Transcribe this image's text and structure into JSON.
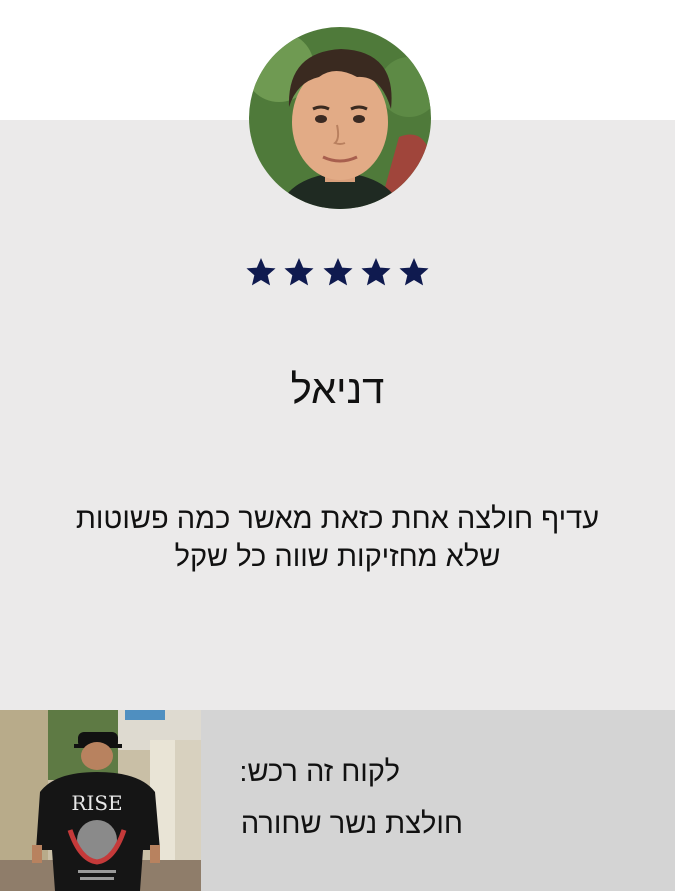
{
  "review": {
    "avatar_icon": "person-avatar-photo",
    "rating": 5,
    "rating_max": 5,
    "star_color": "#0f1a4f",
    "reviewer_name": "דניאל",
    "text_line_1": "עדיף חולצה אחת כזאת מאשר כמה פשוטות",
    "text_line_2": "שלא מחזיקות שווה כל שקל"
  },
  "purchase": {
    "photo_icon": "product-photo",
    "label": "לקוח זה רכש:",
    "product_name": "חולצת נשר שחורה",
    "shirt_print": "RISE"
  },
  "colors": {
    "card_background": "#ebeaea",
    "panel_background": "#d4d4d4"
  }
}
